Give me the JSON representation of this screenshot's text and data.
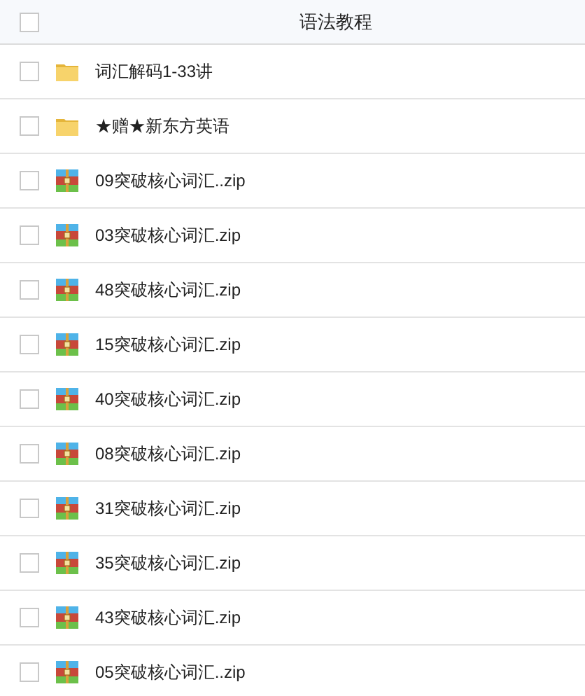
{
  "header": {
    "title": "语法教程",
    "checked": false
  },
  "files": [
    {
      "kind": "folder",
      "name": "词汇解码1-33讲",
      "checked": false
    },
    {
      "kind": "folder",
      "name": "★赠★新东方英语",
      "checked": false
    },
    {
      "kind": "zip",
      "name": "09突破核心词汇..zip",
      "checked": false
    },
    {
      "kind": "zip",
      "name": "03突破核心词汇.zip",
      "checked": false
    },
    {
      "kind": "zip",
      "name": "48突破核心词汇.zip",
      "checked": false
    },
    {
      "kind": "zip",
      "name": "15突破核心词汇.zip",
      "checked": false
    },
    {
      "kind": "zip",
      "name": "40突破核心词汇.zip",
      "checked": false
    },
    {
      "kind": "zip",
      "name": "08突破核心词汇.zip",
      "checked": false
    },
    {
      "kind": "zip",
      "name": "31突破核心词汇.zip",
      "checked": false
    },
    {
      "kind": "zip",
      "name": "35突破核心词汇.zip",
      "checked": false
    },
    {
      "kind": "zip",
      "name": "43突破核心词汇.zip",
      "checked": false
    },
    {
      "kind": "zip",
      "name": "05突破核心词汇..zip",
      "checked": false
    }
  ]
}
